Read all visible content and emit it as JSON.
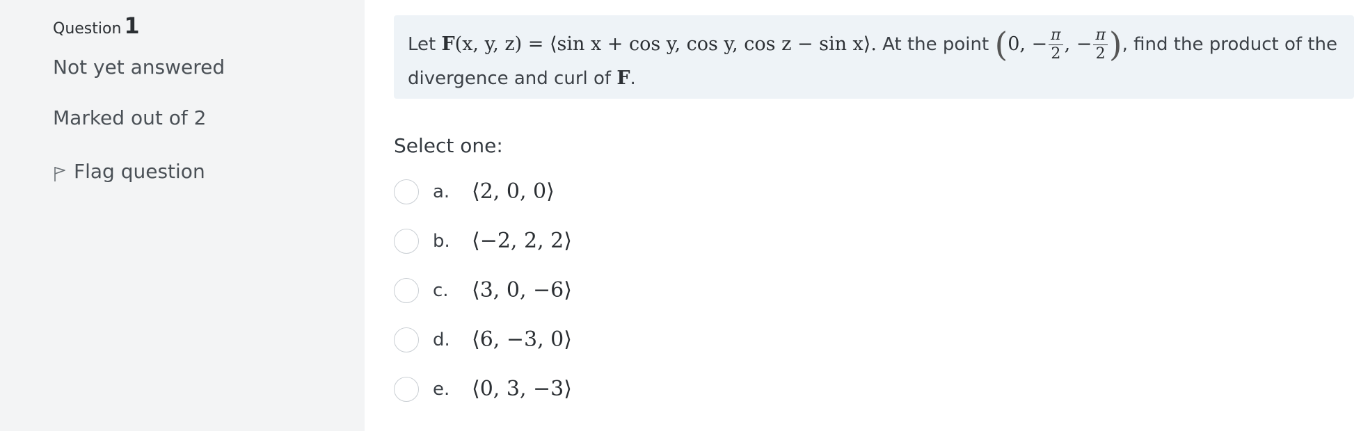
{
  "info": {
    "question_label": "Question",
    "question_number": "1",
    "state": "Not yet answered",
    "grade": "Marked out of 2",
    "flag_label": "Flag question"
  },
  "question": {
    "intro": "Let",
    "func_name": "F",
    "args": "(x, y, z) = ⟨sin x + cos y, cos y, cos z − sin x⟩.",
    "point_text": "At the point",
    "point_open": "(",
    "point_first": "0, −",
    "pi1": "π",
    "two1": "2",
    "comma": ", −",
    "pi2": "π",
    "two2": "2",
    "point_close": ")",
    "tail": ", find the product of the",
    "line2": "divergence and curl of",
    "line2_F": "F",
    "line2_end": "."
  },
  "prompt": "Select one:",
  "options": [
    {
      "letter": "a.",
      "value": "⟨2, 0, 0⟩"
    },
    {
      "letter": "b.",
      "value": "⟨−2, 2, 2⟩"
    },
    {
      "letter": "c.",
      "value": "⟨3, 0, −6⟩"
    },
    {
      "letter": "d.",
      "value": "⟨6, −3, 0⟩"
    },
    {
      "letter": "e.",
      "value": "⟨0, 3, −3⟩"
    }
  ],
  "icons": {
    "flag": "flag-outline-icon"
  },
  "colors": {
    "sidebar_bg": "#f3f4f5",
    "question_bg": "#eef3f7"
  }
}
